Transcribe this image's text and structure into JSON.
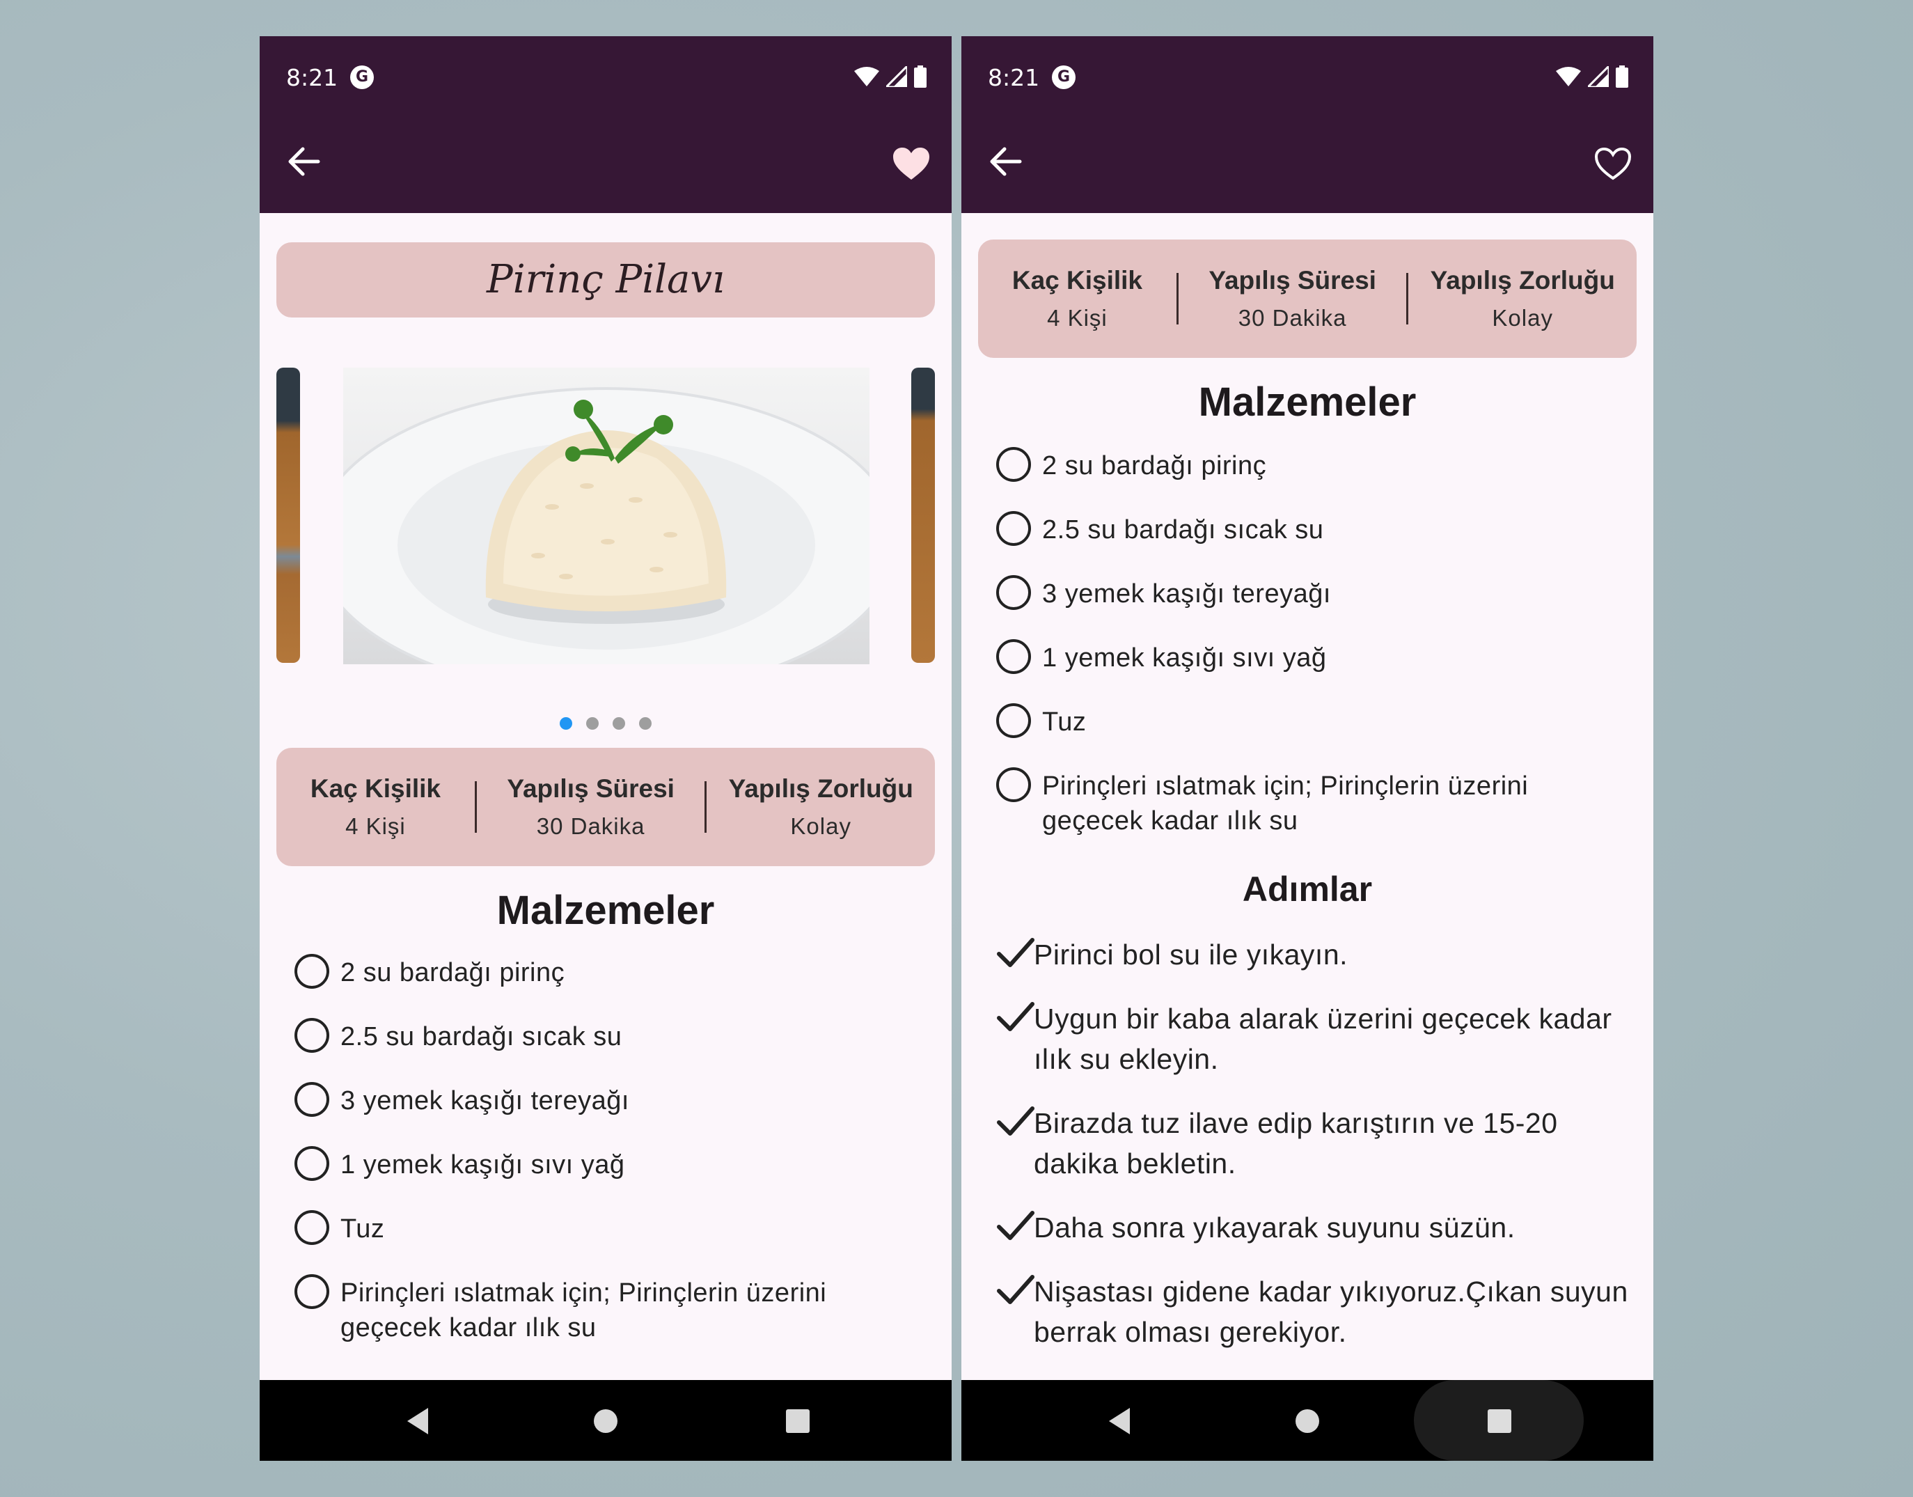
{
  "colors": {
    "appbar": "#361735",
    "card": "#e4c3c3",
    "page": "#fcf6fb",
    "dot_active": "#2196f3",
    "dot": "#9e9e9e",
    "heart_filled": "#fde0e4"
  },
  "status": {
    "time": "8:21",
    "icons": [
      "app-g-icon",
      "wifi-icon",
      "signal-icon",
      "battery-icon"
    ]
  },
  "left": {
    "appbar": {
      "back_icon": "arrow-left-icon",
      "favorite_icon": "heart-filled-icon"
    },
    "title": "Pirinç Pilavı",
    "carousel": {
      "count": 4,
      "active_index": 0
    },
    "info": [
      {
        "label": "Kaç Kişilik",
        "value": "4 Kişi"
      },
      {
        "label": "Yapılış Süresi",
        "value": "30 Dakika"
      },
      {
        "label": "Yapılış Zorluğu",
        "value": "Kolay"
      }
    ],
    "ingredients_title": "Malzemeler",
    "ingredients": [
      "2 su bardağı pirinç",
      "2.5 su bardağı sıcak su",
      "3 yemek kaşığı tereyağı",
      "1 yemek kaşığı sıvı yağ",
      "Tuz",
      "Pirinçleri ıslatmak için; Pirinçlerin üzerini geçecek kadar ılık su"
    ]
  },
  "right": {
    "appbar": {
      "back_icon": "arrow-left-icon",
      "favorite_icon": "heart-outline-icon"
    },
    "info": [
      {
        "label": "Kaç Kişilik",
        "value": "4 Kişi"
      },
      {
        "label": "Yapılış Süresi",
        "value": "30 Dakika"
      },
      {
        "label": "Yapılış Zorluğu",
        "value": "Kolay"
      }
    ],
    "ingredients_title": "Malzemeler",
    "ingredients": [
      "2 su bardağı pirinç",
      "2.5 su bardağı sıcak su",
      "3 yemek kaşığı tereyağı",
      "1 yemek kaşığı sıvı yağ",
      "Tuz",
      "Pirinçleri ıslatmak için; Pirinçlerin üzerini geçecek kadar ılık su"
    ],
    "steps_title": "Adımlar",
    "steps": [
      "Pirinci bol su ile yıkayın.",
      "Uygun bir kaba alarak üzerini geçecek kadar ılık su ekleyin.",
      "Birazda tuz ilave edip karıştırın ve 15-20 dakika bekletin.",
      "Daha sonra yıkayarak suyunu süzün.",
      "Nişastası gidene kadar yıkıyoruz.Çıkan suyun berrak olması gerekiyor."
    ]
  },
  "navbar": {
    "icons": [
      "back-triangle-icon",
      "home-circle-icon",
      "recents-square-icon"
    ]
  }
}
